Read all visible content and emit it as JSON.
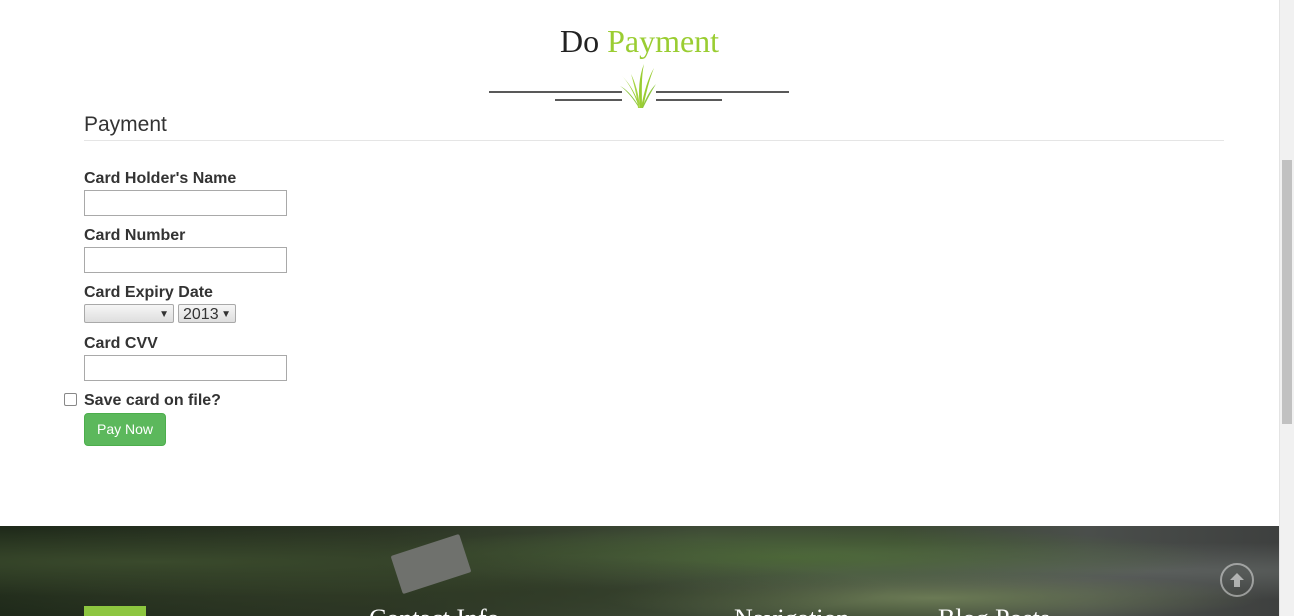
{
  "heading": {
    "part1": "Do",
    "part2": "Payment"
  },
  "form": {
    "legend": "Payment",
    "card_holder_label": "Card Holder's Name",
    "card_holder_value": "",
    "card_number_label": "Card Number",
    "card_number_value": "",
    "expiry_label": "Card Expiry Date",
    "expiry_month_value": "",
    "expiry_year_value": "2013",
    "cvv_label": "Card CVV",
    "cvv_value": "",
    "save_card_label": "Save card on file?",
    "save_card_checked": false,
    "submit_label": "Pay Now"
  },
  "footer": {
    "headings": [
      "Contact Info",
      "Navigation",
      "Blog Posts"
    ]
  },
  "colors": {
    "accent": "#9ACD32",
    "button": "#5cb85c"
  },
  "icons": [
    "grass-ornament-icon",
    "scroll-to-top-icon"
  ]
}
